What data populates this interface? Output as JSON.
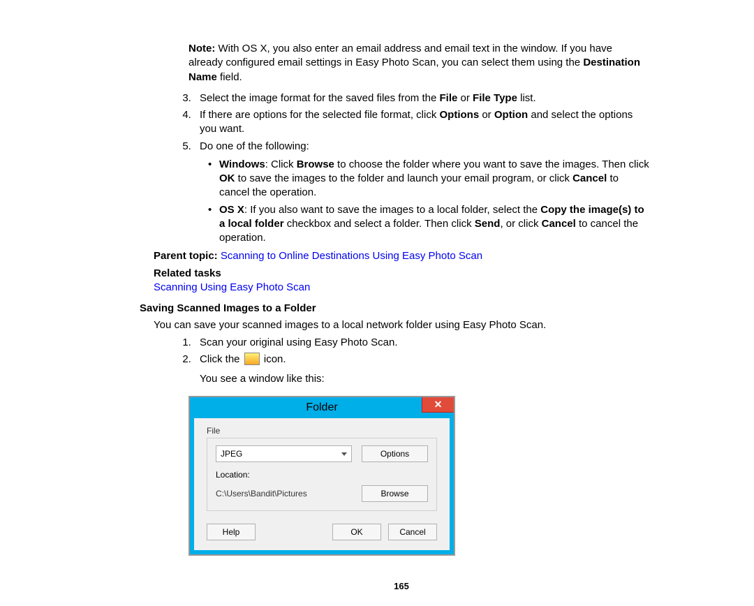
{
  "note_prefix": "Note:",
  "note_body": " With OS X, you also enter an email address and email text in the window. If you have already configured email settings in Easy Photo Scan, you can select them using the ",
  "note_bold1": "Destination Name",
  "note_body2": " field.",
  "steps_top": {
    "s3_a": "Select the image format for the saved files from the ",
    "s3_b1": "File",
    "s3_mid": " or ",
    "s3_b2": "File Type",
    "s3_c": " list.",
    "s4_a": "If there are options for the selected file format, click ",
    "s4_b1": "Options",
    "s4_mid": " or ",
    "s4_b2": "Option",
    "s4_c": " and select the options you want.",
    "s5": "Do one of the following:",
    "s5_win_b": "Windows",
    "s5_win_a": ": Click ",
    "s5_win_b2": "Browse",
    "s5_win_c": " to choose the folder where you want to save the images. Then click ",
    "s5_win_b3": "OK",
    "s5_win_d": " to save the images to the folder and launch your email program, or click ",
    "s5_win_b4": "Cancel",
    "s5_win_e": " to cancel the operation.",
    "s5_osx_b": "OS X",
    "s5_osx_a": ": If you also want to save the images to a local folder, select the ",
    "s5_osx_b2": "Copy the image(s) to a local folder",
    "s5_osx_c": " checkbox and select a folder. Then click ",
    "s5_osx_b3": "Send",
    "s5_osx_d": ", or click ",
    "s5_osx_b4": "Cancel",
    "s5_osx_e": " to cancel the operation."
  },
  "parent_label": "Parent topic:",
  "parent_link": "Scanning to Online Destinations Using Easy Photo Scan",
  "related_label": "Related tasks",
  "related_link": "Scanning Using Easy Photo Scan",
  "section_heading": "Saving Scanned Images to a Folder",
  "section_intro": "You can save your scanned images to a local network folder using Easy Photo Scan.",
  "steps_bottom": {
    "s1": "Scan your original using Easy Photo Scan.",
    "s2_a": "Click the ",
    "s2_b": " icon.",
    "after": "You see a window like this:"
  },
  "dialog": {
    "title": "Folder",
    "group": "File",
    "combo_value": "JPEG",
    "options_btn": "Options",
    "loc_label": "Location:",
    "loc_path": "C:\\Users\\Bandit\\Pictures",
    "browse_btn": "Browse",
    "help_btn": "Help",
    "ok_btn": "OK",
    "cancel_btn": "Cancel"
  },
  "page_number": "165"
}
